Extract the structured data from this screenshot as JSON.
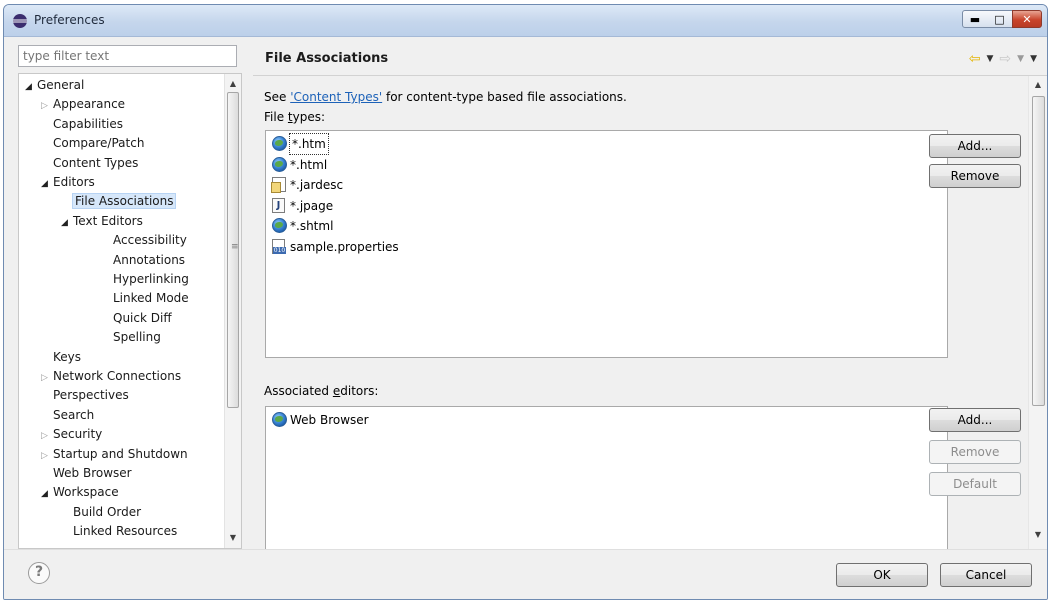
{
  "window": {
    "title": "Preferences"
  },
  "filter": {
    "placeholder": "type filter text"
  },
  "tree": [
    {
      "label": "General",
      "level": 0,
      "toggle": "open"
    },
    {
      "label": "Appearance",
      "level": 1,
      "toggle": "closed"
    },
    {
      "label": "Capabilities",
      "level": 1,
      "toggle": "none"
    },
    {
      "label": "Compare/Patch",
      "level": 1,
      "toggle": "none"
    },
    {
      "label": "Content Types",
      "level": 1,
      "toggle": "none"
    },
    {
      "label": "Editors",
      "level": 1,
      "toggle": "open"
    },
    {
      "label": "File Associations",
      "level": 2,
      "toggle": "none",
      "selected": true
    },
    {
      "label": "Text Editors",
      "level": 2,
      "toggle": "open"
    },
    {
      "label": "Accessibility",
      "level": 3,
      "toggle": "none"
    },
    {
      "label": "Annotations",
      "level": 3,
      "toggle": "none"
    },
    {
      "label": "Hyperlinking",
      "level": 3,
      "toggle": "none"
    },
    {
      "label": "Linked Mode",
      "level": 3,
      "toggle": "none"
    },
    {
      "label": "Quick Diff",
      "level": 3,
      "toggle": "none"
    },
    {
      "label": "Spelling",
      "level": 3,
      "toggle": "none"
    },
    {
      "label": "Keys",
      "level": 1,
      "toggle": "none"
    },
    {
      "label": "Network Connections",
      "level": 1,
      "toggle": "closed"
    },
    {
      "label": "Perspectives",
      "level": 1,
      "toggle": "none"
    },
    {
      "label": "Search",
      "level": 1,
      "toggle": "none"
    },
    {
      "label": "Security",
      "level": 1,
      "toggle": "closed"
    },
    {
      "label": "Startup and Shutdown",
      "level": 1,
      "toggle": "closed"
    },
    {
      "label": "Web Browser",
      "level": 1,
      "toggle": "none"
    },
    {
      "label": "Workspace",
      "level": 1,
      "toggle": "open"
    },
    {
      "label": "Build Order",
      "level": 2,
      "toggle": "none"
    },
    {
      "label": "Linked Resources",
      "level": 2,
      "toggle": "none"
    }
  ],
  "page": {
    "title": "File Associations",
    "see_prefix": "See ",
    "see_link": "'Content Types'",
    "see_suffix": " for content-type based file associations.",
    "file_types_label_pre": "File ",
    "file_types_label_u": "t",
    "file_types_label_post": "ypes:",
    "associated_label_pre": "Associated ",
    "associated_label_u": "e",
    "associated_label_post": "ditors:"
  },
  "file_types": [
    {
      "name": "*.htm",
      "icon": "globe-icon",
      "selected": true
    },
    {
      "name": "*.html",
      "icon": "globe-icon"
    },
    {
      "name": "*.jardesc",
      "icon": "jar-description-icon"
    },
    {
      "name": "*.jpage",
      "icon": "java-page-icon"
    },
    {
      "name": "*.shtml",
      "icon": "globe-icon"
    },
    {
      "name": "sample.properties",
      "icon": "properties-file-icon"
    }
  ],
  "associated_editors": [
    {
      "name": "Web Browser",
      "icon": "globe-icon"
    }
  ],
  "buttons": {
    "add_types": "Add...",
    "remove_types": "Remove",
    "add_editor": "Add...",
    "remove_editor": "Remove",
    "default_editor": "Default",
    "ok": "OK",
    "cancel": "Cancel"
  },
  "help_glyph": "?",
  "colors": {
    "accent_link": "#1d62b8",
    "selection": "#d6e7fa",
    "nav_back": "#e4b400"
  }
}
